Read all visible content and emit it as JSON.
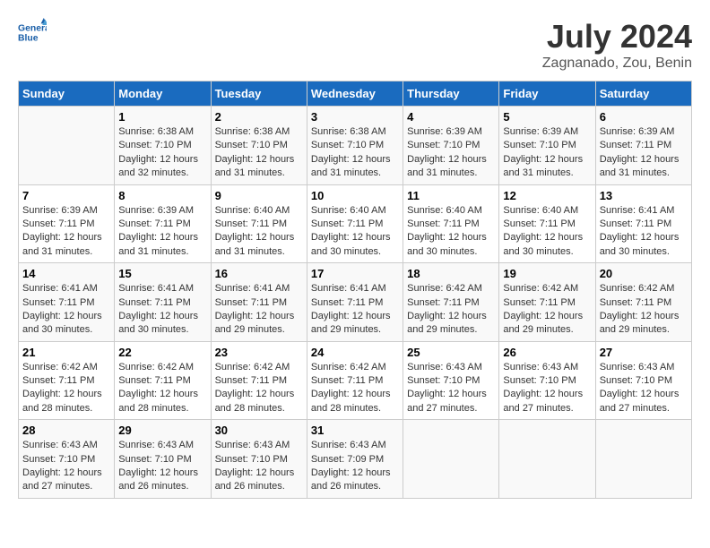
{
  "logo": {
    "line1": "General",
    "line2": "Blue"
  },
  "title": "July 2024",
  "subtitle": "Zagnanado, Zou, Benin",
  "weekdays": [
    "Sunday",
    "Monday",
    "Tuesday",
    "Wednesday",
    "Thursday",
    "Friday",
    "Saturday"
  ],
  "weeks": [
    [
      {
        "day": "",
        "sunrise": "",
        "sunset": "",
        "daylight": ""
      },
      {
        "day": "1",
        "sunrise": "Sunrise: 6:38 AM",
        "sunset": "Sunset: 7:10 PM",
        "daylight": "Daylight: 12 hours and 32 minutes."
      },
      {
        "day": "2",
        "sunrise": "Sunrise: 6:38 AM",
        "sunset": "Sunset: 7:10 PM",
        "daylight": "Daylight: 12 hours and 31 minutes."
      },
      {
        "day": "3",
        "sunrise": "Sunrise: 6:38 AM",
        "sunset": "Sunset: 7:10 PM",
        "daylight": "Daylight: 12 hours and 31 minutes."
      },
      {
        "day": "4",
        "sunrise": "Sunrise: 6:39 AM",
        "sunset": "Sunset: 7:10 PM",
        "daylight": "Daylight: 12 hours and 31 minutes."
      },
      {
        "day": "5",
        "sunrise": "Sunrise: 6:39 AM",
        "sunset": "Sunset: 7:10 PM",
        "daylight": "Daylight: 12 hours and 31 minutes."
      },
      {
        "day": "6",
        "sunrise": "Sunrise: 6:39 AM",
        "sunset": "Sunset: 7:11 PM",
        "daylight": "Daylight: 12 hours and 31 minutes."
      }
    ],
    [
      {
        "day": "7",
        "sunrise": "Sunrise: 6:39 AM",
        "sunset": "Sunset: 7:11 PM",
        "daylight": "Daylight: 12 hours and 31 minutes."
      },
      {
        "day": "8",
        "sunrise": "Sunrise: 6:39 AM",
        "sunset": "Sunset: 7:11 PM",
        "daylight": "Daylight: 12 hours and 31 minutes."
      },
      {
        "day": "9",
        "sunrise": "Sunrise: 6:40 AM",
        "sunset": "Sunset: 7:11 PM",
        "daylight": "Daylight: 12 hours and 31 minutes."
      },
      {
        "day": "10",
        "sunrise": "Sunrise: 6:40 AM",
        "sunset": "Sunset: 7:11 PM",
        "daylight": "Daylight: 12 hours and 30 minutes."
      },
      {
        "day": "11",
        "sunrise": "Sunrise: 6:40 AM",
        "sunset": "Sunset: 7:11 PM",
        "daylight": "Daylight: 12 hours and 30 minutes."
      },
      {
        "day": "12",
        "sunrise": "Sunrise: 6:40 AM",
        "sunset": "Sunset: 7:11 PM",
        "daylight": "Daylight: 12 hours and 30 minutes."
      },
      {
        "day": "13",
        "sunrise": "Sunrise: 6:41 AM",
        "sunset": "Sunset: 7:11 PM",
        "daylight": "Daylight: 12 hours and 30 minutes."
      }
    ],
    [
      {
        "day": "14",
        "sunrise": "Sunrise: 6:41 AM",
        "sunset": "Sunset: 7:11 PM",
        "daylight": "Daylight: 12 hours and 30 minutes."
      },
      {
        "day": "15",
        "sunrise": "Sunrise: 6:41 AM",
        "sunset": "Sunset: 7:11 PM",
        "daylight": "Daylight: 12 hours and 30 minutes."
      },
      {
        "day": "16",
        "sunrise": "Sunrise: 6:41 AM",
        "sunset": "Sunset: 7:11 PM",
        "daylight": "Daylight: 12 hours and 29 minutes."
      },
      {
        "day": "17",
        "sunrise": "Sunrise: 6:41 AM",
        "sunset": "Sunset: 7:11 PM",
        "daylight": "Daylight: 12 hours and 29 minutes."
      },
      {
        "day": "18",
        "sunrise": "Sunrise: 6:42 AM",
        "sunset": "Sunset: 7:11 PM",
        "daylight": "Daylight: 12 hours and 29 minutes."
      },
      {
        "day": "19",
        "sunrise": "Sunrise: 6:42 AM",
        "sunset": "Sunset: 7:11 PM",
        "daylight": "Daylight: 12 hours and 29 minutes."
      },
      {
        "day": "20",
        "sunrise": "Sunrise: 6:42 AM",
        "sunset": "Sunset: 7:11 PM",
        "daylight": "Daylight: 12 hours and 29 minutes."
      }
    ],
    [
      {
        "day": "21",
        "sunrise": "Sunrise: 6:42 AM",
        "sunset": "Sunset: 7:11 PM",
        "daylight": "Daylight: 12 hours and 28 minutes."
      },
      {
        "day": "22",
        "sunrise": "Sunrise: 6:42 AM",
        "sunset": "Sunset: 7:11 PM",
        "daylight": "Daylight: 12 hours and 28 minutes."
      },
      {
        "day": "23",
        "sunrise": "Sunrise: 6:42 AM",
        "sunset": "Sunset: 7:11 PM",
        "daylight": "Daylight: 12 hours and 28 minutes."
      },
      {
        "day": "24",
        "sunrise": "Sunrise: 6:42 AM",
        "sunset": "Sunset: 7:11 PM",
        "daylight": "Daylight: 12 hours and 28 minutes."
      },
      {
        "day": "25",
        "sunrise": "Sunrise: 6:43 AM",
        "sunset": "Sunset: 7:10 PM",
        "daylight": "Daylight: 12 hours and 27 minutes."
      },
      {
        "day": "26",
        "sunrise": "Sunrise: 6:43 AM",
        "sunset": "Sunset: 7:10 PM",
        "daylight": "Daylight: 12 hours and 27 minutes."
      },
      {
        "day": "27",
        "sunrise": "Sunrise: 6:43 AM",
        "sunset": "Sunset: 7:10 PM",
        "daylight": "Daylight: 12 hours and 27 minutes."
      }
    ],
    [
      {
        "day": "28",
        "sunrise": "Sunrise: 6:43 AM",
        "sunset": "Sunset: 7:10 PM",
        "daylight": "Daylight: 12 hours and 27 minutes."
      },
      {
        "day": "29",
        "sunrise": "Sunrise: 6:43 AM",
        "sunset": "Sunset: 7:10 PM",
        "daylight": "Daylight: 12 hours and 26 minutes."
      },
      {
        "day": "30",
        "sunrise": "Sunrise: 6:43 AM",
        "sunset": "Sunset: 7:10 PM",
        "daylight": "Daylight: 12 hours and 26 minutes."
      },
      {
        "day": "31",
        "sunrise": "Sunrise: 6:43 AM",
        "sunset": "Sunset: 7:09 PM",
        "daylight": "Daylight: 12 hours and 26 minutes."
      },
      {
        "day": "",
        "sunrise": "",
        "sunset": "",
        "daylight": ""
      },
      {
        "day": "",
        "sunrise": "",
        "sunset": "",
        "daylight": ""
      },
      {
        "day": "",
        "sunrise": "",
        "sunset": "",
        "daylight": ""
      }
    ]
  ]
}
